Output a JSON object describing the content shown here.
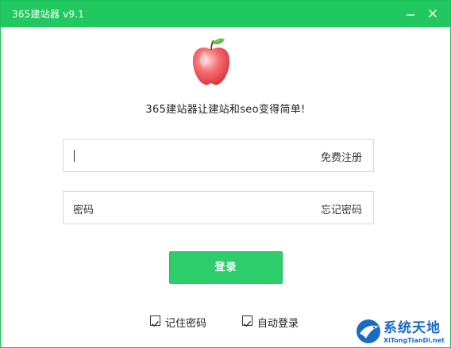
{
  "window": {
    "title": "365建站器 v9.1",
    "accent_color": "#20c85f"
  },
  "titlebar": {
    "minimize_icon": "minimize-icon",
    "close_icon": "close-icon"
  },
  "logo": {
    "icon": "apple-logo-icon"
  },
  "slogan": "365建站器让建站和seo变得简单!",
  "username": {
    "value": "",
    "link_label": "免费注册"
  },
  "password": {
    "label": "密码",
    "link_label": "忘记密码"
  },
  "login_button": {
    "label": "登录"
  },
  "options": {
    "remember_password": {
      "label": "记住密码",
      "checked": true
    },
    "auto_login": {
      "label": "自动登录",
      "checked": true
    }
  },
  "watermark": {
    "title": "系统天地",
    "subtitle": "XiTongTianDi.net"
  }
}
